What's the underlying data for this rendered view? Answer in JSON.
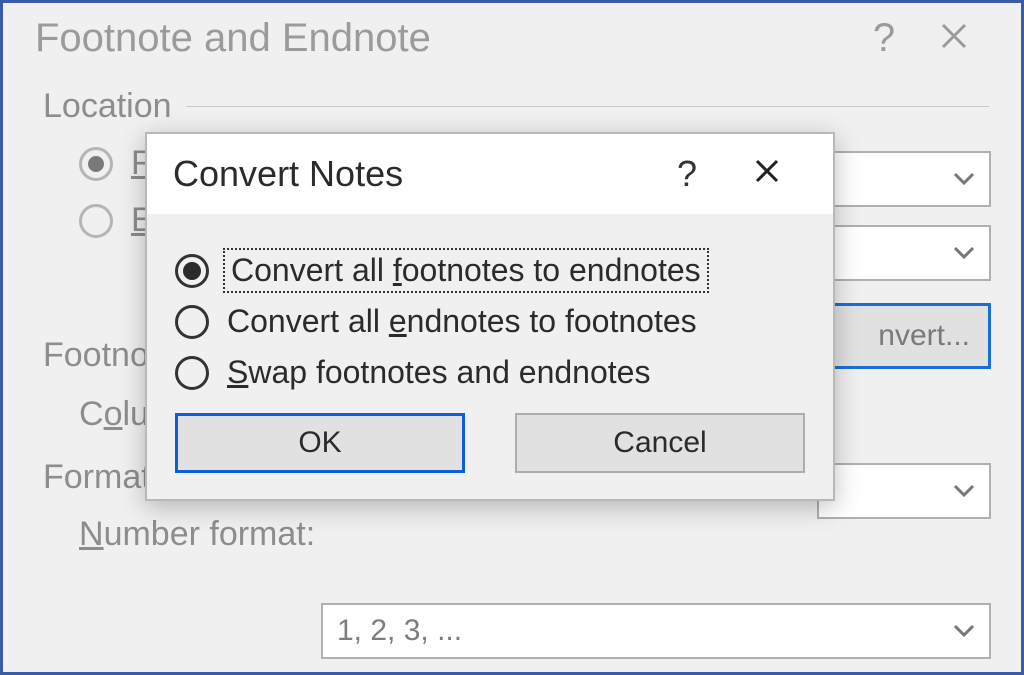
{
  "parent": {
    "title": "Footnote and Endnote",
    "sections": {
      "location": "Location",
      "footnote_layout": "Footnote layout",
      "format": "Format"
    },
    "radio_footnotes_prefix": "F",
    "radio_endnotes_prefix": "E",
    "columns_label_prefix": "C",
    "columns_label_rest": "lumn",
    "number_format_label": "Number format:",
    "number_format_value": "1, 2, 3, ...",
    "convert_button": "nvert..."
  },
  "modal": {
    "title": "Convert Notes",
    "options": [
      {
        "text_pre": "Convert all ",
        "accel": "f",
        "text_post": "ootnotes to endnotes",
        "selected": true,
        "focused": true
      },
      {
        "text_pre": "Convert all ",
        "accel": "e",
        "text_post": "ndnotes to footnotes",
        "selected": false,
        "focused": false
      },
      {
        "text_pre": "",
        "accel": "S",
        "text_post": "wap footnotes and endnotes",
        "selected": false,
        "focused": false
      }
    ],
    "ok": "OK",
    "cancel": "Cancel"
  }
}
